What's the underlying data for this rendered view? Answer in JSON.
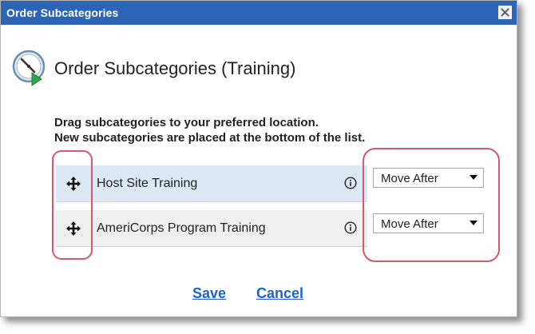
{
  "dialog": {
    "window_title": "Order Subcategories",
    "close_icon": "close-icon",
    "header_title": "Order Subcategories (Training)",
    "header_icon": "clock-play-icon",
    "instructions": {
      "line1": "Drag subcategories to your preferred location.",
      "line2": "New subcategories are placed at the bottom of the list."
    },
    "rows": [
      {
        "label": "Host Site Training",
        "action": "Move After",
        "drag_icon": "move-icon",
        "info_icon": "info-icon"
      },
      {
        "label": "AmeriCorps Program Training",
        "action": "Move After",
        "drag_icon": "move-icon",
        "info_icon": "info-icon"
      }
    ],
    "footer": {
      "save_label": "Save",
      "cancel_label": "Cancel"
    }
  },
  "colors": {
    "titlebar": "#2d65b6",
    "link": "#1d63c6",
    "highlight": "#d9566c",
    "row_selected": "#dce8f4",
    "row_default": "#f0f0f0"
  }
}
